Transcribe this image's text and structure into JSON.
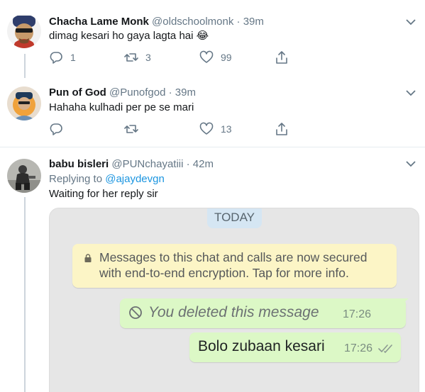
{
  "tweets": [
    {
      "name": "Chacha Lame Monk",
      "handle": "@oldschoolmonk",
      "dot": "·",
      "time": "39m",
      "text": "dimag kesari ho gaya lagta hai 😂",
      "reply_count": "1",
      "retweet_count": "3",
      "like_count": "99"
    },
    {
      "name": "Pun of God",
      "handle": "@Punofgod",
      "dot": "·",
      "time": "39m",
      "text": "Hahaha kulhadi per pe se mari",
      "reply_count": "",
      "retweet_count": "",
      "like_count": "13"
    },
    {
      "name": "babu bisleri",
      "handle": "@PUNchayatiii",
      "dot": "·",
      "time": "42m",
      "replying_prefix": "Replying to ",
      "replying_to": "@ajaydevgn",
      "text": "Waiting for her reply sir"
    }
  ],
  "whatsapp": {
    "date_chip": "TODAY",
    "encryption_notice_line1": "Messages to this chat and calls are now secured",
    "encryption_notice_line2": "with end-to-end encryption. Tap for more info.",
    "deleted_message": "You deleted this message",
    "deleted_time": "17:26",
    "message": "Bolo zubaan kesari",
    "message_time": "17:26"
  },
  "icons": {
    "reply": "reply-icon",
    "retweet": "retweet-icon",
    "like": "heart-icon",
    "share": "share-icon",
    "more": "chevron-down-icon"
  },
  "colors": {
    "icon_gray": "#657786",
    "link_blue": "#1b95e0",
    "wa_bubble": "#dcf8c6",
    "wa_notice": "#fcf5c6",
    "wa_chip": "#d5e6f3"
  }
}
